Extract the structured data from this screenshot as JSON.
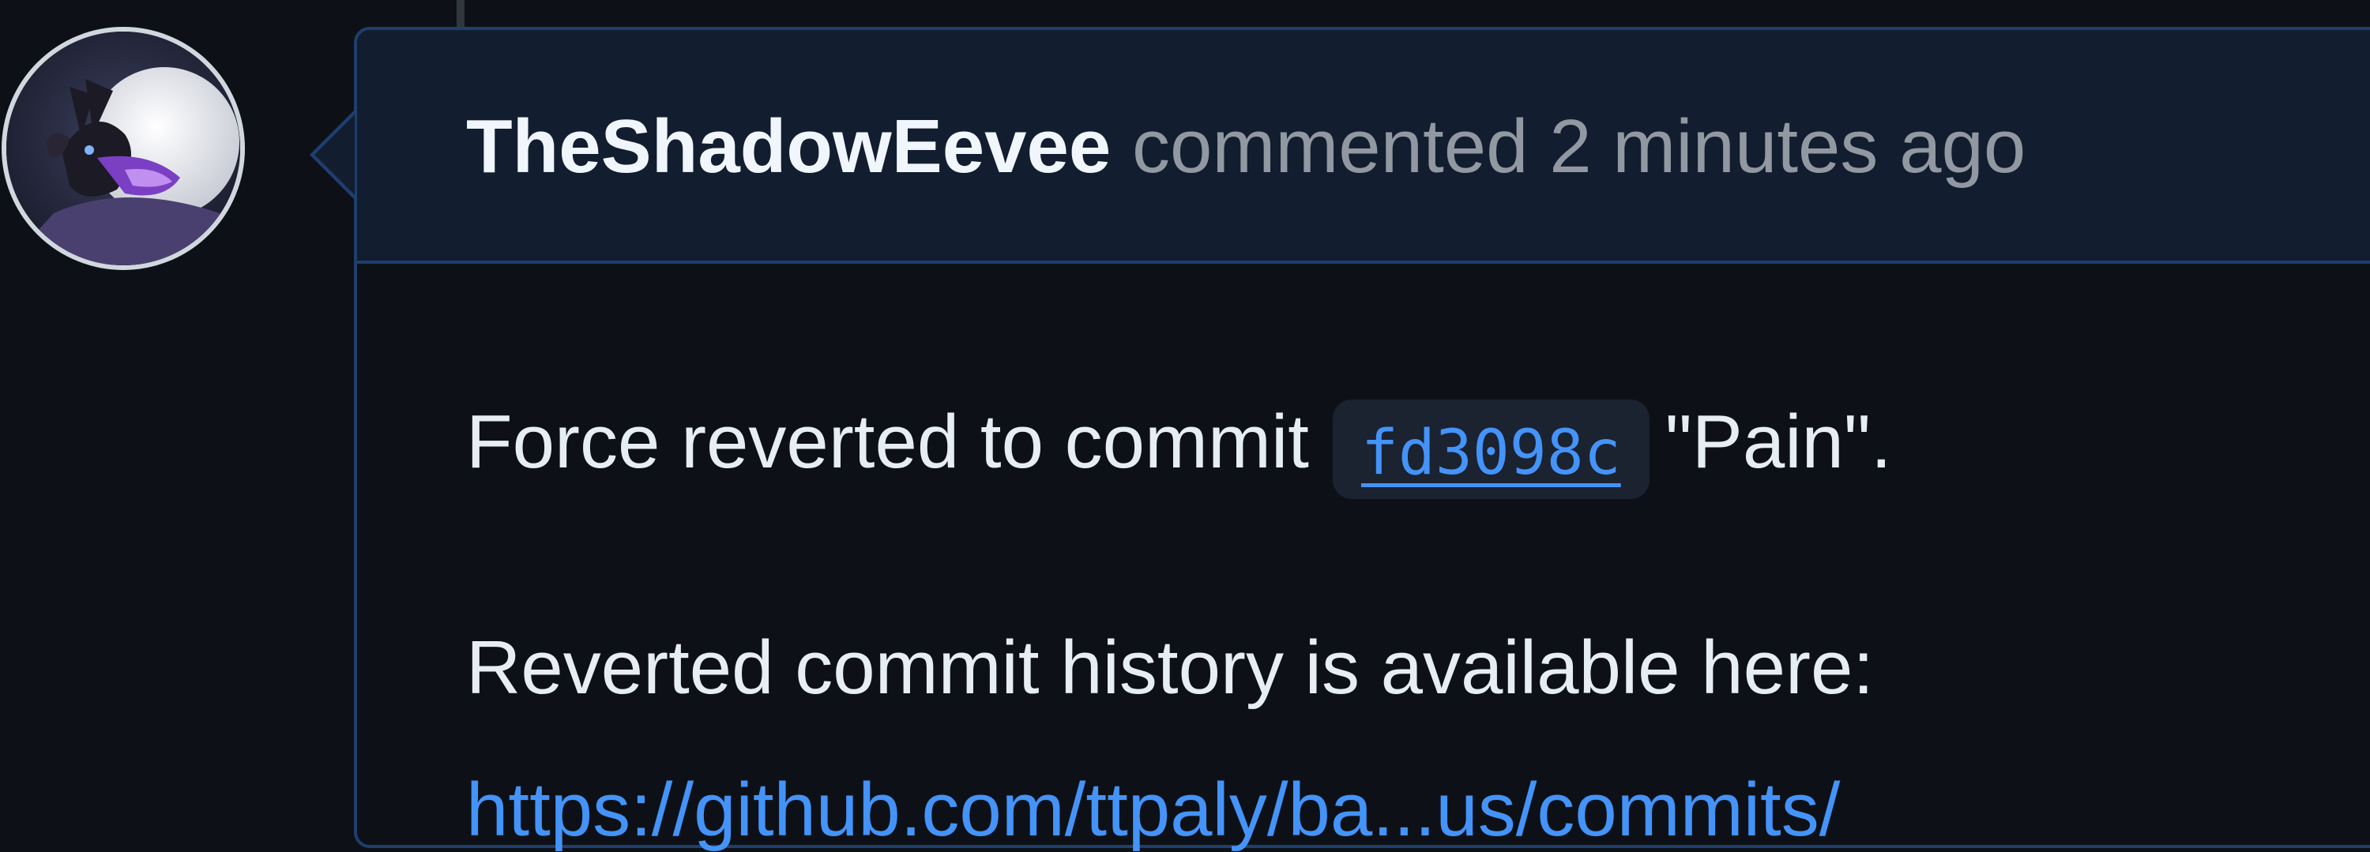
{
  "comment": {
    "author": "TheShadowEevee",
    "action": "commented",
    "timestamp": "2 minutes ago",
    "line1_before": "Force reverted to commit",
    "commit_sha": "fd3098c",
    "line1_after": "\"Pain\".",
    "line2": "Reverted commit history is available here:",
    "link_partial": "https://github.com/ttpaly/ba...us/commits/"
  },
  "colors": {
    "background": "#0d1117",
    "header_bg": "#121d2f",
    "border": "#1f3f6d",
    "link": "#4493f8",
    "muted_text": "#9198a1",
    "primary_text": "#e6edf3"
  },
  "icons": {
    "avatar": "eevee-avatar"
  }
}
